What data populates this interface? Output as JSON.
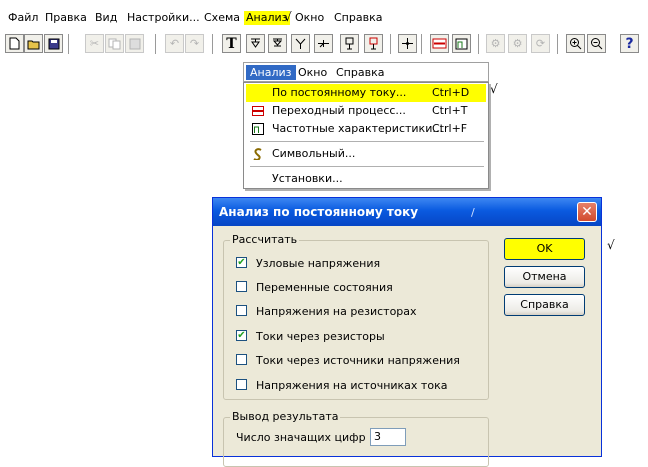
{
  "menubar": {
    "items": [
      "Файл",
      "Правка",
      "Вид",
      "Настройки...",
      "Схема",
      "Анализ",
      "Окно",
      "Справка"
    ],
    "highlight_color": "#ffff00"
  },
  "check_symbol": "√",
  "toolbar": {
    "buttons": [
      "new-icon",
      "open-icon",
      "save-icon",
      "cut-icon",
      "copy-icon",
      "paste-icon",
      "undo-icon",
      "redo-icon",
      "text-icon",
      "node-icon",
      "node-alt-icon",
      "branch-icon",
      "branch-alt-icon",
      "probe-icon",
      "probe-alt-icon",
      "crosshair-icon",
      "resistor-icon",
      "frequency-icon",
      "component-icon",
      "component-alt-icon",
      "rotate-icon",
      "zoom-in-icon",
      "zoom-out-icon",
      "help-icon"
    ],
    "text_tool": "T",
    "help": "?"
  },
  "menu": {
    "header": [
      "Анализ",
      "Окно",
      "Справка"
    ],
    "items": [
      {
        "label": "По постоянному току...",
        "shortcut": "Ctrl+D",
        "icon": "dc-analysis-icon"
      },
      {
        "label": "Переходный процесс...",
        "shortcut": "Ctrl+T",
        "icon": "transient-icon"
      },
      {
        "label": "Частотные характеристики...",
        "shortcut": "Ctrl+F",
        "icon": "frequency-icon"
      },
      {
        "label": "Символьный...",
        "shortcut": "",
        "icon": "symbolic-icon"
      },
      {
        "label": "Установки...",
        "shortcut": "",
        "icon": ""
      }
    ]
  },
  "dialog": {
    "title": "Анализ по постоянному току",
    "calc_group": {
      "label": "Рассчитать",
      "options": [
        {
          "label": "Узловые напряжения",
          "checked": true
        },
        {
          "label": "Переменные состояния",
          "checked": false
        },
        {
          "label": "Напряжения на резисторах",
          "checked": false
        },
        {
          "label": "Токи через резисторы",
          "checked": true
        },
        {
          "label": "Токи через источники напряжения",
          "checked": false
        },
        {
          "label": "Напряжения на источниках тока",
          "checked": false
        }
      ]
    },
    "output_group": {
      "label": "Вывод результата",
      "digits_label": "Число значащих цифр :",
      "digits_value": "3"
    },
    "buttons": {
      "ok": "OK",
      "cancel": "Отмена",
      "help": "Справка"
    },
    "cursor_mark": "/"
  }
}
